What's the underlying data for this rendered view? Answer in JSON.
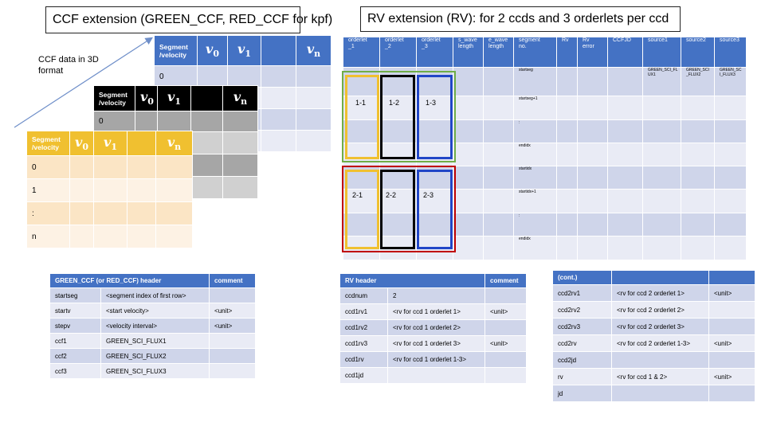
{
  "ccf": {
    "title": "CCF extension   (GREEN_CCF, RED_CCF for kpf)",
    "note_line1": "CCF data in 3D",
    "note_line2": "format",
    "hdr_seg1": "Segment",
    "hdr_seg2": "/velocity",
    "v0": "v",
    "v0_sub": "0",
    "v1": "v",
    "v1_sub": "1",
    "vn": "v",
    "vn_sub": "n",
    "blue_rows": [
      "0",
      "",
      "",
      ""
    ],
    "black_rows": [
      "0",
      "",
      "",
      "",
      ""
    ],
    "yellow_rows": [
      "0",
      "1",
      ":",
      "n"
    ]
  },
  "rv": {
    "title": "RV extension (RV): for 2 ccds and 3 orderlets per ccd",
    "headers": [
      "orderlet\n_1",
      "orderlet\n_2",
      "orderlet\n_3",
      "s_wave\nlength",
      "e_wave\nlength",
      "segment\nno.",
      "Rv",
      "Rv\nerror",
      "CCFJD",
      "source1",
      "source2",
      "source3"
    ],
    "segments": [
      "startseg",
      "startseg+1",
      ":",
      "endidx",
      "startidx",
      "startidx+1",
      ":",
      "endidx"
    ],
    "sources": [
      "GREEN_SCI_FL\nUX1",
      "GREEN_SCI\n_FLUX2",
      "GREEN_SC\nI_FLUX3"
    ],
    "ccd1_labels": [
      "1-1",
      "1-2",
      "1-3"
    ],
    "ccd2_labels": [
      "2-1",
      "2-2",
      "2-3"
    ]
  },
  "ccf_header": {
    "title": "GREEN_CCF (or RED_CCF) header",
    "comment_col": "comment",
    "rows": [
      [
        "startseg",
        "<segment index of first row>",
        ""
      ],
      [
        "startv",
        "<start velocity>",
        "<unit>"
      ],
      [
        "stepv",
        "<velocity interval>",
        "<unit>"
      ],
      [
        "ccf1",
        "GREEN_SCI_FLUX1",
        ""
      ],
      [
        "ccf2",
        "GREEN_SCI_FLUX2",
        ""
      ],
      [
        "ccf3",
        "GREEN_SCI_FLUX3",
        ""
      ]
    ]
  },
  "rv_header": {
    "title": "RV header",
    "comment_col": "comment",
    "rows": [
      [
        "ccdnum",
        "2",
        ""
      ],
      [
        "ccd1rv1",
        "<rv for ccd 1 orderlet 1>",
        "<unit>"
      ],
      [
        "ccd1rv2",
        "<rv for ccd 1 orderlet 2>",
        ""
      ],
      [
        "ccd1rv3",
        "<rv for ccd 1 orderlet 3>",
        "<unit>"
      ],
      [
        "ccd1rv",
        "<rv for ccd 1 orderlet 1-3>",
        ""
      ],
      [
        "ccd1jd",
        "",
        ""
      ]
    ]
  },
  "cont_header": {
    "title": "(cont.)",
    "rows": [
      [
        "ccd2rv1",
        "<rv for ccd 2 orderlet 1>",
        "<unit>"
      ],
      [
        "ccd2rv2",
        "<rv for ccd 2 orderlet 2>",
        ""
      ],
      [
        "ccd2rv3",
        "<rv for ccd 2 orderlet 3>",
        ""
      ],
      [
        "ccd2rv",
        "<rv for ccd 2 orderlet 1-3>",
        "<unit>"
      ],
      [
        "ccd2jd",
        "",
        ""
      ],
      [
        "rv",
        "<rv for ccd 1 & 2>",
        "<unit>"
      ],
      [
        "jd",
        "",
        ""
      ]
    ]
  },
  "colors": {
    "blue": "#4472c4",
    "green": "#70ad47",
    "red": "#c00000",
    "yellow": "#f0c030",
    "black": "#000000",
    "rowA": "#cfd5ea",
    "rowB": "#e9ebf5"
  }
}
